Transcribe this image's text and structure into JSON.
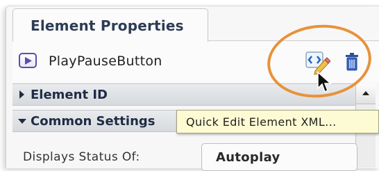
{
  "tab": {
    "label": "Element Properties"
  },
  "element": {
    "name": "PlayPauseButton",
    "icon": "play-icon"
  },
  "toolbar": {
    "quick_edit_icon": "xml-edit-icon",
    "delete_icon": "trash-icon"
  },
  "sections": [
    {
      "label": "Element ID",
      "expanded": false
    },
    {
      "label": "Common Settings",
      "expanded": true
    }
  ],
  "properties": [
    {
      "label": "Displays Status Of:",
      "value": "Autoplay"
    }
  ],
  "tooltip": {
    "text": "Quick Edit Element XML..."
  },
  "colors": {
    "highlight": "#e8923a",
    "tooltip_bg": "#fdfbd3",
    "accent": "#2d3c55"
  }
}
